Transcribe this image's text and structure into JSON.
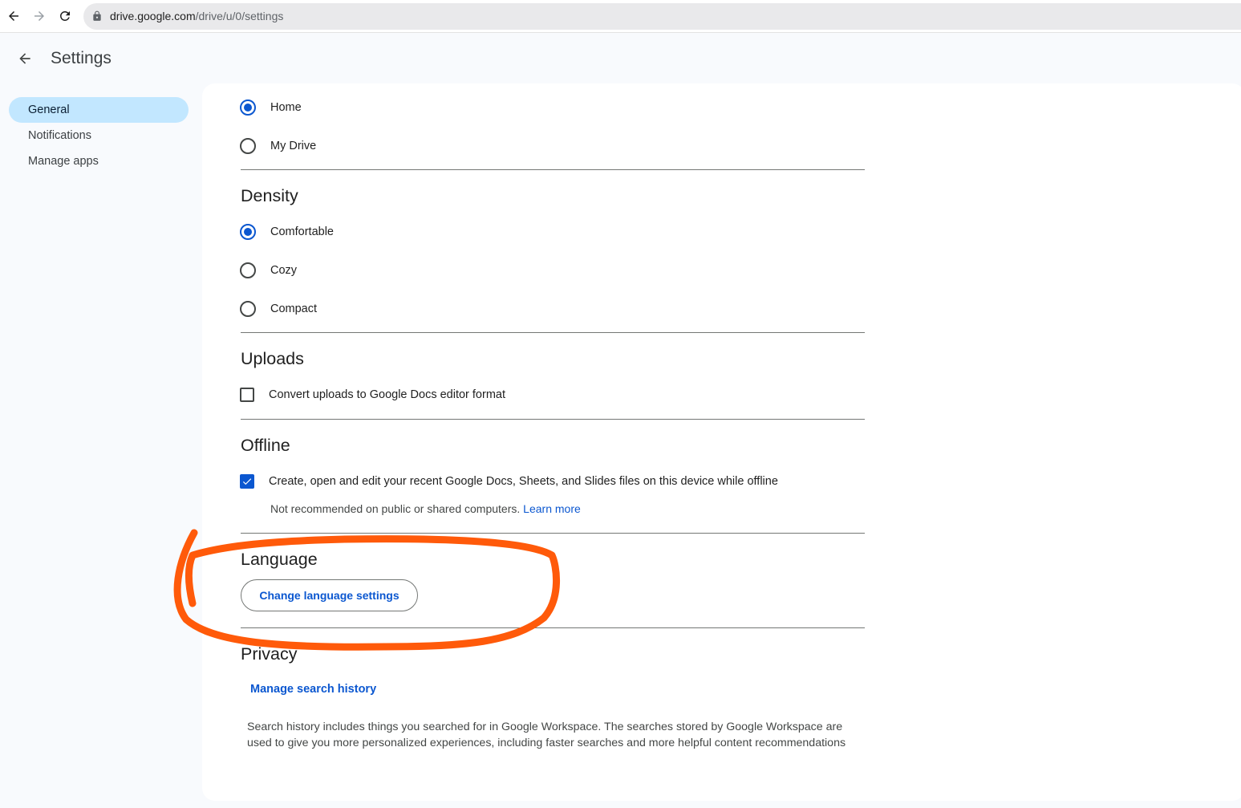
{
  "browser": {
    "url_host": "drive.google.com",
    "url_path": "/drive/u/0/settings"
  },
  "header": {
    "title": "Settings"
  },
  "sidebar": {
    "items": [
      {
        "label": "General"
      },
      {
        "label": "Notifications"
      },
      {
        "label": "Manage apps"
      }
    ],
    "active": "General"
  },
  "start_page": {
    "options": [
      {
        "label": "Home",
        "selected": true
      },
      {
        "label": "My Drive",
        "selected": false
      }
    ]
  },
  "density": {
    "title": "Density",
    "options": [
      {
        "label": "Comfortable",
        "selected": true
      },
      {
        "label": "Cozy",
        "selected": false
      },
      {
        "label": "Compact",
        "selected": false
      }
    ]
  },
  "uploads": {
    "title": "Uploads",
    "convert_label": "Convert uploads to Google Docs editor format",
    "convert_checked": false
  },
  "offline": {
    "title": "Offline",
    "label": "Create, open and edit your recent Google Docs, Sheets, and Slides files on this device while offline",
    "checked": true,
    "note": "Not recommended on public or shared computers.",
    "learn_more": "Learn more"
  },
  "language": {
    "title": "Language",
    "button_label": "Change language settings"
  },
  "privacy": {
    "title": "Privacy",
    "manage_label": "Manage search history",
    "description": "Search history includes things you searched for in Google Workspace. The searches stored by Google Workspace are used to give you more personalized experiences, including faster searches and more helpful content recommendations"
  },
  "colors": {
    "accent": "#0b57d0",
    "active_nav": "#c2e7ff",
    "annotation": "#ff5a0a"
  }
}
